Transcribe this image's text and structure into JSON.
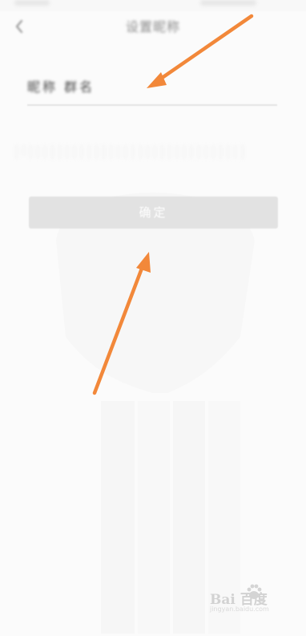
{
  "nav": {
    "title": "设置昵称"
  },
  "form": {
    "nickname_value": "昵称  群名",
    "hint_text": "| l | | | | | | | | | | | | | | | | | | | | | | | | | | | | | |"
  },
  "actions": {
    "confirm_label": "确定"
  },
  "icons": {
    "back": "back-chevron-icon",
    "annotation": "annotation-arrow-icon",
    "watermark": "baidu-paw-icon"
  },
  "watermark": {
    "brand": "Bai 百度",
    "url": "jingyan.baidu.com"
  },
  "colors": {
    "annotation_arrow": "#f2883a",
    "button_bg": "#e2e2e2",
    "button_text": "#ffffff",
    "page_bg": "#fbfbfb"
  }
}
